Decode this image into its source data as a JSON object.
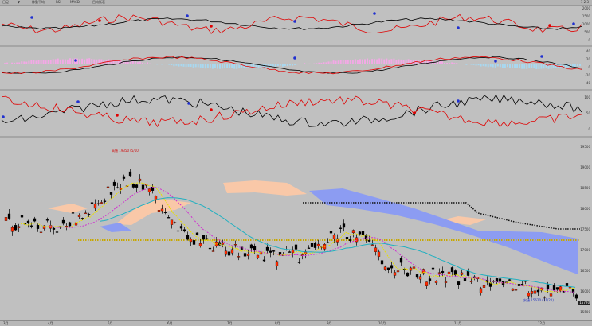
{
  "toolbar": {
    "items": [
      "日足",
      "▼",
      "移動平均",
      "RSI",
      "MACD",
      "一目均衡表"
    ],
    "right_label": "1 2 3"
  },
  "panes": {
    "indicator1": {
      "scale": [
        "2000",
        "1500",
        "1000",
        "500",
        "0"
      ]
    },
    "indicator2": {
      "scale": [
        "40",
        "20",
        "0",
        "-20",
        "-40"
      ]
    },
    "indicator3": {
      "scale": [
        "100",
        "50",
        "0"
      ]
    },
    "price": {
      "scale": [
        "19500",
        "19000",
        "18500",
        "18000",
        "17500",
        "17000",
        "16500",
        "16000",
        "15500"
      ],
      "high_label": "高値 19350 (5/10)",
      "low_label": "安値 15620 (11/22)",
      "last_price": "15720"
    }
  },
  "status": {
    "dates": [
      "3月",
      "4月",
      "5月",
      "6月",
      "7月",
      "8月",
      "9月",
      "10月",
      "11月",
      "12月"
    ]
  },
  "colors": {
    "bg": "#c0c0c0",
    "bull": "#ff2a00",
    "bear": "#000000",
    "kumo_up": "#f9c8a8",
    "kumo_down": "#8c9cf2",
    "ma_short": "#e8e000",
    "ma_mid": "#d030d0",
    "ma_long": "#20b0c0"
  }
}
